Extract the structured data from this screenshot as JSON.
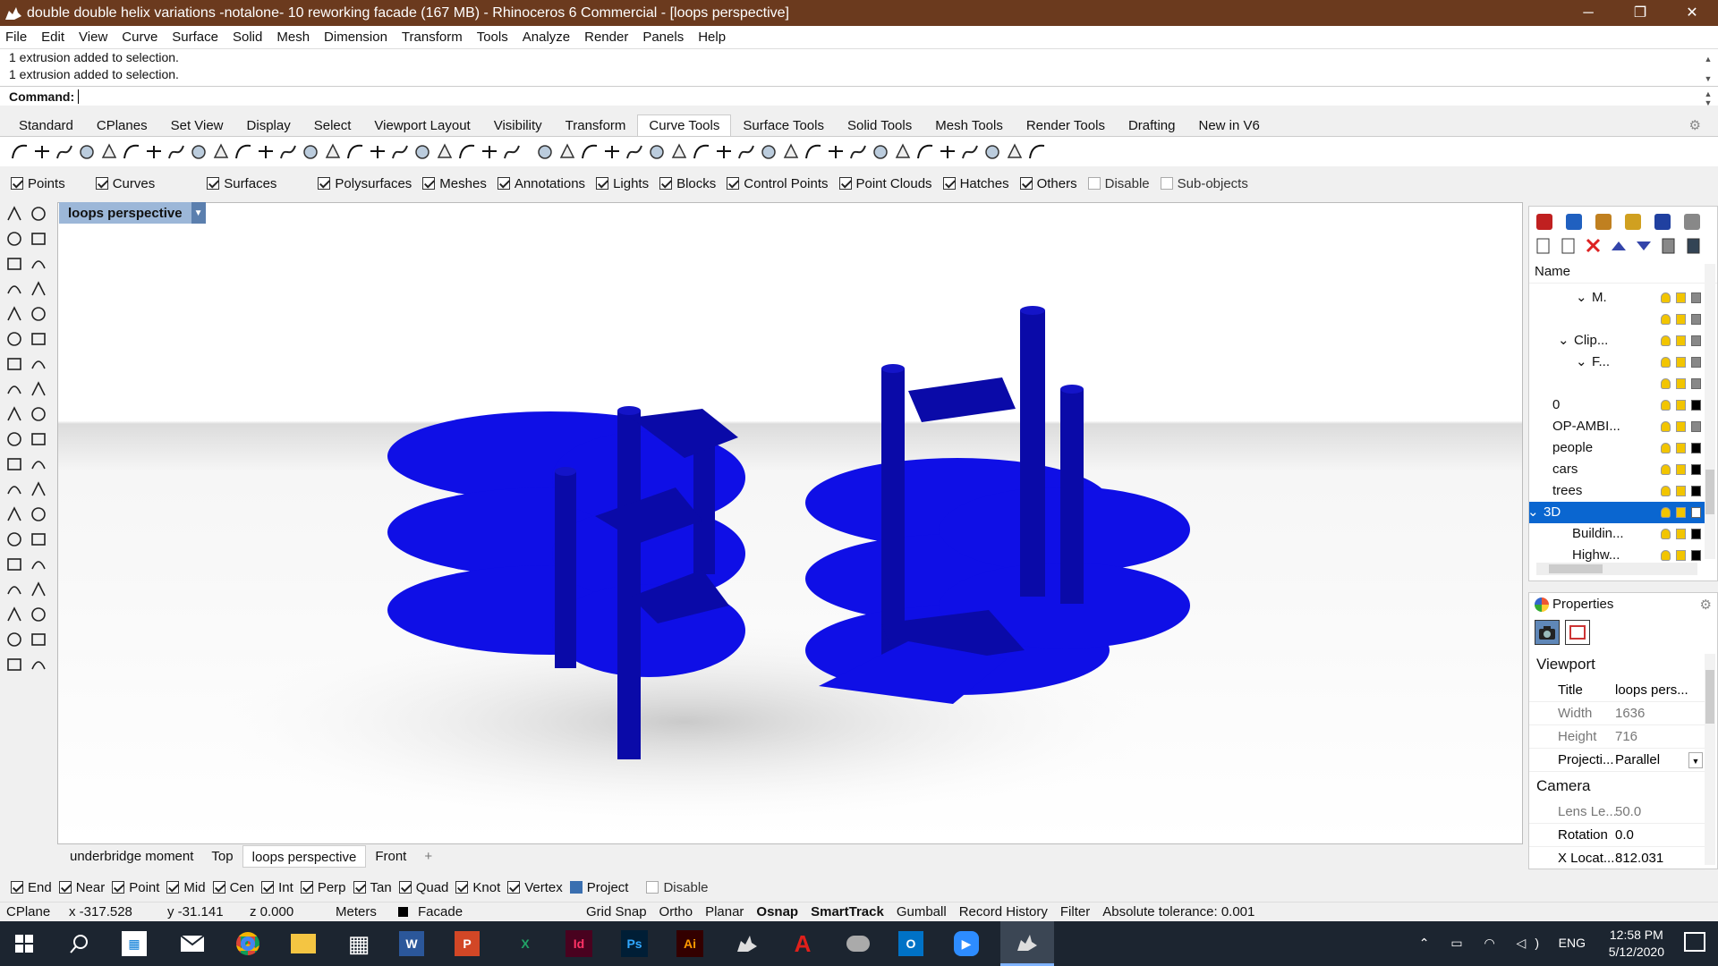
{
  "window": {
    "title": "double double helix variations -notalone- 10 reworking facade (167 MB) - Rhinoceros 6 Commercial - [loops perspective]",
    "controls": [
      "─",
      "❐",
      "✕"
    ]
  },
  "menu": [
    "File",
    "Edit",
    "View",
    "Curve",
    "Surface",
    "Solid",
    "Mesh",
    "Dimension",
    "Transform",
    "Tools",
    "Analyze",
    "Render",
    "Panels",
    "Help"
  ],
  "command": {
    "history": [
      "1 extrusion added to selection.",
      "1 extrusion added to selection."
    ],
    "prompt": "Command:"
  },
  "toolbar_tabs": [
    "Standard",
    "CPlanes",
    "Set View",
    "Display",
    "Select",
    "Viewport Layout",
    "Visibility",
    "Transform",
    "Curve Tools",
    "Surface Tools",
    "Solid Tools",
    "Mesh Tools",
    "Render Tools",
    "Drafting",
    "New in V6"
  ],
  "active_toolbar_tab": "Curve Tools",
  "selection_filters": [
    {
      "label": "Points",
      "checked": true
    },
    {
      "label": "Curves",
      "checked": true
    },
    {
      "label": "Surfaces",
      "checked": true
    },
    {
      "label": "Polysurfaces",
      "checked": true
    },
    {
      "label": "Meshes",
      "checked": true
    },
    {
      "label": "Annotations",
      "checked": true
    },
    {
      "label": "Lights",
      "checked": true
    },
    {
      "label": "Blocks",
      "checked": true
    },
    {
      "label": "Control Points",
      "checked": true
    },
    {
      "label": "Point Clouds",
      "checked": true
    },
    {
      "label": "Hatches",
      "checked": true
    },
    {
      "label": "Others",
      "checked": true
    },
    {
      "label": "Disable",
      "checked": false
    },
    {
      "label": "Sub-objects",
      "checked": false
    }
  ],
  "viewport": {
    "name": "loops perspective",
    "model_color": "#0f0fe6"
  },
  "viewport_tabs": [
    "underbridge moment",
    "Top",
    "loops perspective",
    "Front",
    "+"
  ],
  "active_viewport_tab": "loops perspective",
  "osnaps": [
    {
      "label": "End",
      "checked": true
    },
    {
      "label": "Near",
      "checked": true
    },
    {
      "label": "Point",
      "checked": true
    },
    {
      "label": "Mid",
      "checked": true
    },
    {
      "label": "Cen",
      "checked": true
    },
    {
      "label": "Int",
      "checked": true
    },
    {
      "label": "Perp",
      "checked": true
    },
    {
      "label": "Tan",
      "checked": true
    },
    {
      "label": "Quad",
      "checked": true
    },
    {
      "label": "Knot",
      "checked": true
    },
    {
      "label": "Vertex",
      "checked": true
    },
    {
      "label": "Project",
      "checked": false
    },
    {
      "label": "Disable",
      "checked": false
    }
  ],
  "status": {
    "cplane": "CPlane",
    "x": "x -317.528",
    "y": "y -31.141",
    "z": "z 0.000",
    "units": "Meters",
    "layer": "Facade",
    "grid_snap": "Grid Snap",
    "ortho": "Ortho",
    "planar": "Planar",
    "osnap": "Osnap",
    "smarttrack": "SmartTrack",
    "gumball": "Gumball",
    "record_history": "Record History",
    "filter": "Filter",
    "tolerance": "Absolute tolerance: 0.001"
  },
  "layers": {
    "header": "Name",
    "rows": [
      {
        "name": "M.",
        "expander": "⌄",
        "color": "#888888",
        "selected": false
      },
      {
        "name": "",
        "expander": "",
        "color": "#888888",
        "selected": false
      },
      {
        "name": "Clip...",
        "expander": "⌄",
        "color": "#888888",
        "selected": false
      },
      {
        "name": "F...",
        "expander": "⌄",
        "color": "#888888",
        "selected": false
      },
      {
        "name": "",
        "expander": "",
        "color": "#888888",
        "selected": false
      },
      {
        "name": "0",
        "expander": "",
        "color": "#000000",
        "selected": false
      },
      {
        "name": "OP-AMBI...",
        "expander": "",
        "color": "#888888",
        "selected": false
      },
      {
        "name": "people",
        "expander": "",
        "color": "#000000",
        "selected": false
      },
      {
        "name": "cars",
        "expander": "",
        "color": "#000000",
        "selected": false
      },
      {
        "name": "trees",
        "expander": "",
        "color": "#000000",
        "selected": false
      },
      {
        "name": "3D",
        "expander": "⌄",
        "color": "#ffffff",
        "selected": true
      },
      {
        "name": "Buildin...",
        "expander": "",
        "color": "#000000",
        "selected": false
      },
      {
        "name": "Highw...",
        "expander": "",
        "color": "#000000",
        "selected": false
      }
    ]
  },
  "properties": {
    "title": "Properties",
    "viewport_section": "Viewport",
    "camera_section": "Camera",
    "viewport_rows": [
      {
        "key": "Title",
        "value": "loops pers...",
        "grey": false
      },
      {
        "key": "Width",
        "value": "1636",
        "grey": true
      },
      {
        "key": "Height",
        "value": "716",
        "grey": true
      },
      {
        "key": "Projecti...",
        "value": "Parallel",
        "grey": false
      }
    ],
    "camera_rows": [
      {
        "key": "Lens Le...",
        "value": "50.0",
        "grey": true
      },
      {
        "key": "Rotation",
        "value": "0.0",
        "grey": false
      },
      {
        "key": "X Locat...",
        "value": "812.031",
        "grey": false
      }
    ]
  },
  "taskbar": {
    "time": "12:58 PM",
    "date": "5/12/2020",
    "language": "ENG",
    "apps": [
      "windows-start",
      "search",
      "store",
      "mail",
      "chrome",
      "file-explorer",
      "calculator",
      "word",
      "powerpoint",
      "excel",
      "indesign",
      "photoshop",
      "illustrator",
      "rhino",
      "acrobat",
      "grasshopper",
      "outlook",
      "zoom",
      "rhino-active"
    ]
  }
}
